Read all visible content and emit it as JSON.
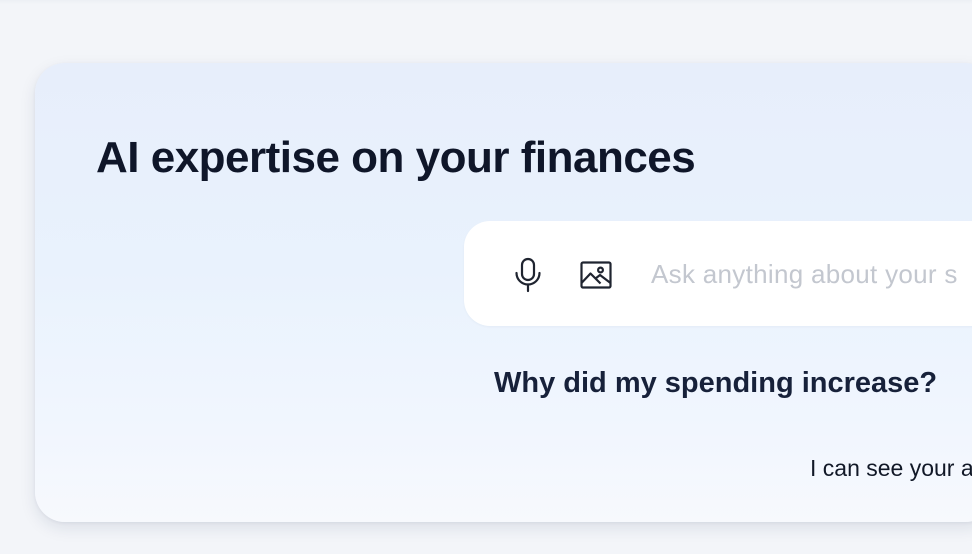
{
  "card": {
    "title": "AI expertise on your finances"
  },
  "ask_bar": {
    "mic_icon": "microphone-icon",
    "image_icon": "image-icon",
    "placeholder": "Ask anything about your s",
    "value": ""
  },
  "conversation": {
    "user_question": "Why did my spending increase?",
    "ai_answer_preview": "I can see your a"
  },
  "colors": {
    "title": "#0f1629",
    "placeholder": "#c3c7cf",
    "card_gradient_top": "#e7eefb",
    "card_gradient_bottom": "#f7f9fd",
    "input_bg": "#ffffff"
  }
}
